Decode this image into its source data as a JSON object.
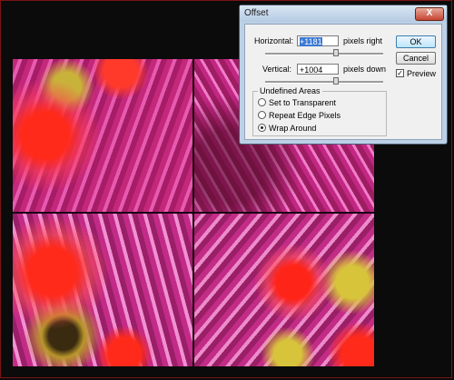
{
  "dialog": {
    "title": "Offset",
    "close_label": "X",
    "horizontal": {
      "label": "Horizontal:",
      "value": "+1181",
      "unit": "pixels right"
    },
    "vertical": {
      "label": "Vertical:",
      "value": "+1004",
      "unit": "pixels down"
    },
    "undefined_areas": {
      "label": "Undefined Areas",
      "options": [
        {
          "label": "Set to Transparent",
          "selected": false
        },
        {
          "label": "Repeat Edge Pixels",
          "selected": false
        },
        {
          "label": "Wrap Around",
          "selected": true
        }
      ]
    },
    "ok_label": "OK",
    "cancel_label": "Cancel",
    "preview_label": "Preview",
    "preview_checked": true
  },
  "colors": {
    "accent": "#3a78d2",
    "dialog_frame": "#bcd0e6",
    "close": "#c64532"
  },
  "icons": {
    "close": "close-icon",
    "check": "check-icon"
  }
}
